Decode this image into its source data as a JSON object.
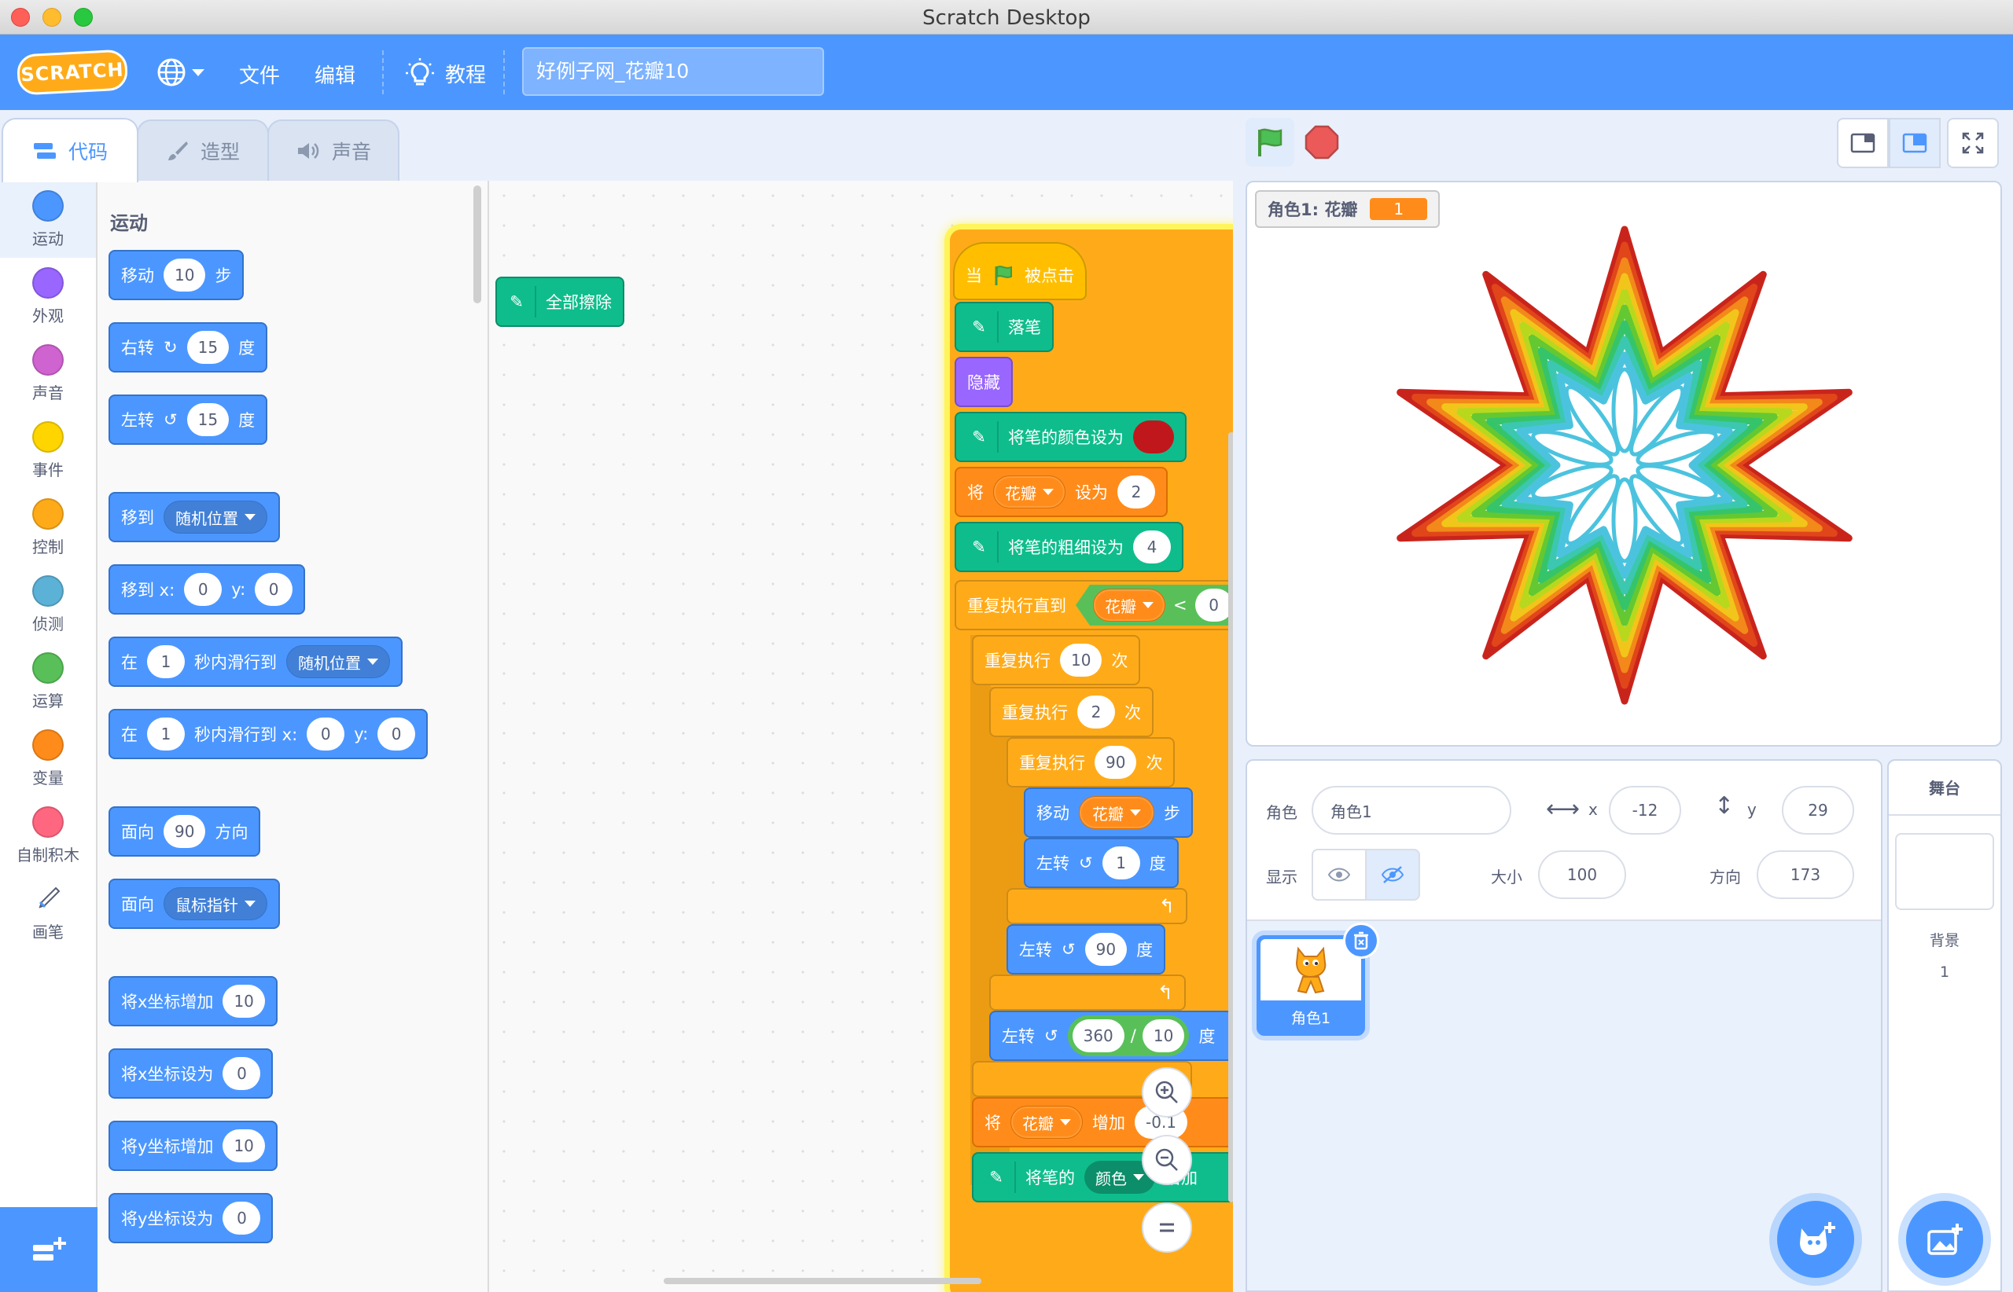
{
  "window": {
    "title": "Scratch Desktop"
  },
  "menu": {
    "logo": "SCRATCH",
    "file": "文件",
    "edit": "编辑",
    "tutorials": "教程",
    "project_title": "好例子网_花瓣10"
  },
  "tabs": [
    {
      "label": "代码"
    },
    {
      "label": "造型"
    },
    {
      "label": "声音"
    }
  ],
  "categories": [
    {
      "label": "运动",
      "color": "#4c97ff"
    },
    {
      "label": "外观",
      "color": "#9966ff"
    },
    {
      "label": "声音",
      "color": "#cf63cf"
    },
    {
      "label": "事件",
      "color": "#ffd500"
    },
    {
      "label": "控制",
      "color": "#ffab19"
    },
    {
      "label": "侦测",
      "color": "#5cb1d6"
    },
    {
      "label": "运算",
      "color": "#59c059"
    },
    {
      "label": "变量",
      "color": "#ff8c1a"
    },
    {
      "label": "自制积木",
      "color": "#ff6680"
    },
    {
      "label": "画笔",
      "color": "#0fbd8c"
    }
  ],
  "palette": {
    "heading": "运动",
    "move": {
      "pre": "移动",
      "val": "10",
      "post": "步"
    },
    "turn_right": {
      "pre": "右转",
      "val": "15",
      "post": "度"
    },
    "turn_left": {
      "pre": "左转",
      "val": "15",
      "post": "度"
    },
    "goto": {
      "pre": "移到",
      "menu": "随机位置"
    },
    "goto_xy": {
      "pre": "移到 x:",
      "x": "0",
      "mid": "y:",
      "y": "0"
    },
    "glide": {
      "pre": "在",
      "secs": "1",
      "mid": "秒内滑行到",
      "menu": "随机位置"
    },
    "glide_xy": {
      "pre": "在",
      "secs": "1",
      "mid": "秒内滑行到 x:",
      "x": "0",
      "mid2": "y:",
      "y": "0"
    },
    "point_dir": {
      "pre": "面向",
      "val": "90",
      "post": "方向"
    },
    "point_towards": {
      "pre": "面向",
      "menu": "鼠标指针"
    },
    "change_x": {
      "pre": "将x坐标增加",
      "val": "10"
    },
    "set_x": {
      "pre": "将x坐标设为",
      "val": "0"
    },
    "change_y": {
      "pre": "将y坐标增加",
      "val": "10"
    },
    "set_y": {
      "pre": "将y坐标设为",
      "val": "0"
    }
  },
  "script": {
    "erase_all": "全部擦除",
    "hat": {
      "pre": "当",
      "post": "被点击"
    },
    "pen_down": "落笔",
    "hide": "隐藏",
    "set_pen_color": "将笔的颜色设为",
    "pen_color_value": "#c0171c",
    "set_var": {
      "pre": "将",
      "var": "花瓣",
      "mid": "设为",
      "val": "2"
    },
    "set_pen_size": {
      "label": "将笔的粗细设为",
      "val": "4"
    },
    "repeat_until": {
      "label": "重复执行直到",
      "var": "花瓣",
      "op": "<",
      "val": "0"
    },
    "repeat1": {
      "pre": "重复执行",
      "val": "10",
      "post": "次"
    },
    "repeat2": {
      "pre": "重复执行",
      "val": "2",
      "post": "次"
    },
    "repeat3": {
      "pre": "重复执行",
      "val": "90",
      "post": "次"
    },
    "move_var": {
      "pre": "移动",
      "var": "花瓣",
      "post": "步"
    },
    "turn1": {
      "pre": "左转",
      "val": "1",
      "post": "度"
    },
    "turn90": {
      "pre": "左转",
      "val": "90",
      "post": "度"
    },
    "turn_div": {
      "pre": "左转",
      "a": "360",
      "op": "/",
      "b": "10",
      "post": "度"
    },
    "change_var": {
      "pre": "将",
      "var": "花瓣",
      "mid": "增加",
      "val": "-0.1"
    },
    "change_pen": {
      "pre": "将笔的",
      "menu": "颜色",
      "mid": "增加"
    }
  },
  "stage": {
    "monitor_label": "角色1: 花瓣",
    "monitor_value": "1"
  },
  "sprite_info": {
    "sprite_label": "角色",
    "sprite_name": "角色1",
    "x_label": "x",
    "x": "-12",
    "y_label": "y",
    "y": "29",
    "show_label": "显示",
    "size_label": "大小",
    "size": "100",
    "direction_label": "方向",
    "direction": "173"
  },
  "sprites": [
    {
      "name": "角色1"
    }
  ],
  "stage_panel": {
    "title": "舞台",
    "backdrop_label": "背景",
    "backdrop_count": "1"
  }
}
